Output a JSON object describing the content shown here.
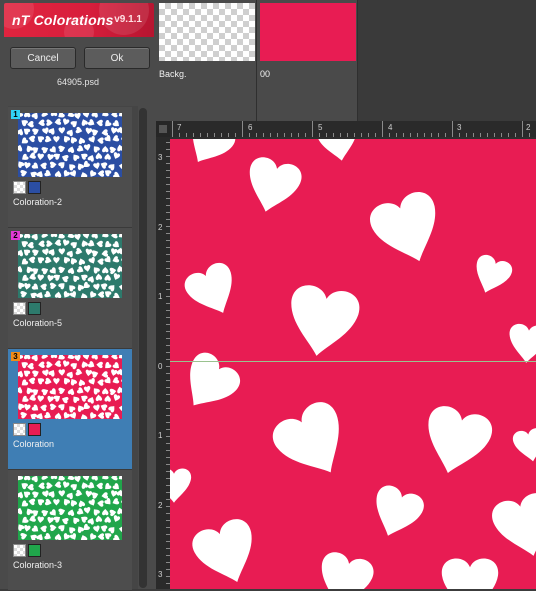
{
  "app": {
    "name": "nT Colorations",
    "version": "v9.1.1",
    "brand_color": "#e0243f"
  },
  "buttons": {
    "cancel": "Cancel",
    "ok": "Ok"
  },
  "file": {
    "name": "64905.psd"
  },
  "colorations": [
    {
      "number": "1",
      "label": "Coloration-2",
      "color": "#2b4ea3",
      "badge_color": "#31d3f5",
      "selected": false
    },
    {
      "number": "2",
      "label": "Coloration-5",
      "color": "#2d7a6c",
      "badge_color": "#e23ad5",
      "selected": false
    },
    {
      "number": "3",
      "label": "Coloration",
      "color": "#e81c53",
      "badge_color": "#f28a16",
      "selected": true
    },
    {
      "number": "",
      "label": "Coloration-3",
      "color": "#20a64b",
      "badge_color": "",
      "selected": false
    }
  ],
  "layers": [
    {
      "label": "Backg.",
      "fill": "transparent"
    },
    {
      "label": "00",
      "fill": "#e81c53"
    }
  ],
  "rulers": {
    "horizontal": [
      "7",
      "6",
      "5",
      "4",
      "3",
      "2"
    ],
    "vertical": [
      "3",
      "2",
      "1",
      "0",
      "1",
      "2",
      "3"
    ]
  },
  "canvas": {
    "background": "#e81c53",
    "pattern": "white hearts"
  },
  "icons": {
    "ruler_origin": "ruler-origin-icon",
    "transparent_swatch": "checkerboard-icon"
  }
}
